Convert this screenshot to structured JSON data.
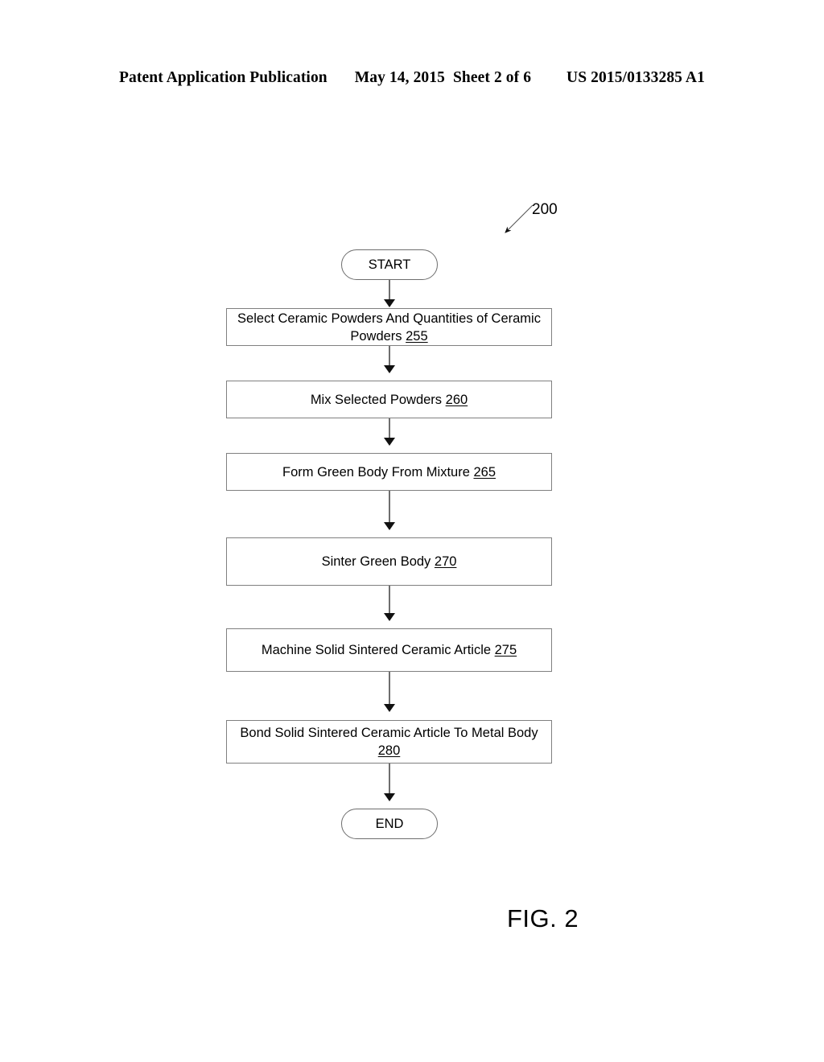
{
  "header": {
    "publication": "Patent Application Publication",
    "date": "May 14, 2015",
    "sheet": "Sheet 2 of 6",
    "doc_number": "US 2015/0133285 A1"
  },
  "figure": {
    "caption": "FIG. 2",
    "callout_number": "200",
    "colors": {
      "box_border": "#808080",
      "connector": "#6e6e6e",
      "arrowhead": "#111111",
      "text": "#000000",
      "background": "#ffffff"
    }
  },
  "flowchart": {
    "title": "200",
    "nodes": [
      {
        "id": "start",
        "shape": "terminal",
        "text": "START",
        "ref": ""
      },
      {
        "id": "255",
        "shape": "process",
        "line1": "Select Ceramic Powders And Quantities of Ceramic",
        "line2": "Powders ",
        "ref": "255"
      },
      {
        "id": "260",
        "shape": "process",
        "text": "Mix Selected Powders ",
        "ref": "260"
      },
      {
        "id": "265",
        "shape": "process",
        "text": "Form Green Body From Mixture  ",
        "ref": "265"
      },
      {
        "id": "270",
        "shape": "process",
        "text": "Sinter Green Body  ",
        "ref": "270"
      },
      {
        "id": "275",
        "shape": "process",
        "text": "Machine Solid Sintered Ceramic Article  ",
        "ref": "275"
      },
      {
        "id": "280",
        "shape": "process",
        "line1": "Bond Solid Sintered Ceramic Article To Metal Body",
        "line2": "",
        "ref": "280"
      },
      {
        "id": "end",
        "shape": "terminal",
        "text": "END",
        "ref": ""
      }
    ]
  }
}
